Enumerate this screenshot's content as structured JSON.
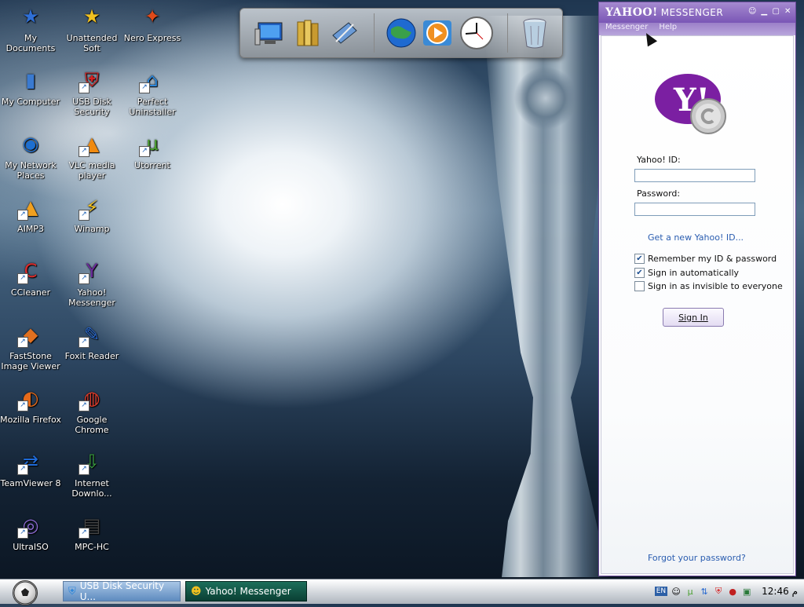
{
  "desktop": {
    "icons": [
      {
        "label": "My Documents",
        "glyph": "★",
        "color": "#2f6fd6"
      },
      {
        "label": "Unattended Soft",
        "glyph": "★",
        "color": "#f0c020"
      },
      {
        "label": "Nero Express",
        "glyph": "✦",
        "color": "#e04a1a"
      },
      {
        "label": "My Computer",
        "glyph": "▮",
        "color": "#3a7ad0"
      },
      {
        "label": "USB Disk Security",
        "glyph": "⛨",
        "color": "#d72020"
      },
      {
        "label": "Perfect Uninstaller",
        "glyph": "⌂",
        "color": "#2c86d9"
      },
      {
        "label": "My Network Places",
        "glyph": "◉",
        "color": "#1e6fd0"
      },
      {
        "label": "VLC media player",
        "glyph": "▲",
        "color": "#f08a10"
      },
      {
        "label": "Utorrent",
        "glyph": "µ",
        "color": "#4aa030"
      },
      {
        "label": "AIMP3",
        "glyph": "▲",
        "color": "#f0a020"
      },
      {
        "label": "Winamp",
        "glyph": "⚡",
        "color": "#f0c020"
      },
      {
        "label": "CCleaner",
        "glyph": "C",
        "color": "#d82b2b"
      },
      {
        "label": "Yahoo! Messenger",
        "glyph": "Y",
        "color": "#6a2a9a"
      },
      {
        "label": "FastStone Image Viewer",
        "glyph": "◆",
        "color": "#e07020"
      },
      {
        "label": "Foxit Reader",
        "glyph": "✎",
        "color": "#2a6ad0"
      },
      {
        "label": "Mozilla Firefox",
        "glyph": "◐",
        "color": "#e66a1a"
      },
      {
        "label": "Google Chrome",
        "glyph": "◍",
        "color": "#d83b2b"
      },
      {
        "label": "TeamViewer 8",
        "glyph": "⇄",
        "color": "#1e6ad8"
      },
      {
        "label": "Internet Downlo...",
        "glyph": "⇩",
        "color": "#3aa040"
      },
      {
        "label": "UltraISO",
        "glyph": "◎",
        "color": "#8a6ad0"
      },
      {
        "label": "MPC-HC",
        "glyph": "▤",
        "color": "#444444"
      }
    ]
  },
  "dock": {
    "items": [
      "computer-icon",
      "folders-icon",
      "pen-tablet-icon",
      "globe-icon",
      "media-player-icon",
      "clock-icon",
      "recycle-bin-icon"
    ]
  },
  "messenger": {
    "title_brand": "YAHOO!",
    "title_product": "MESSENGER",
    "menu": [
      "Messenger",
      "Help"
    ],
    "logo_letter": "Y!",
    "id_label": "Yahoo! ID:",
    "id_value": "",
    "password_label": "Password:",
    "new_id_link": "Get a new Yahoo! ID...",
    "remember": {
      "label": "Remember my ID & password",
      "checked": true
    },
    "auto": {
      "label": "Sign in automatically",
      "checked": true
    },
    "invisible": {
      "label": "Sign in as invisible to everyone",
      "checked": false
    },
    "sign_in_button": "Sign In",
    "forgot_link": "Forgot your password?"
  },
  "taskbar": {
    "tasks": [
      {
        "label": "USB Disk Security U...",
        "active": false
      },
      {
        "label": "Yahoo! Messenger",
        "active": true
      }
    ],
    "lang": "EN",
    "clock": "12:46 م"
  }
}
